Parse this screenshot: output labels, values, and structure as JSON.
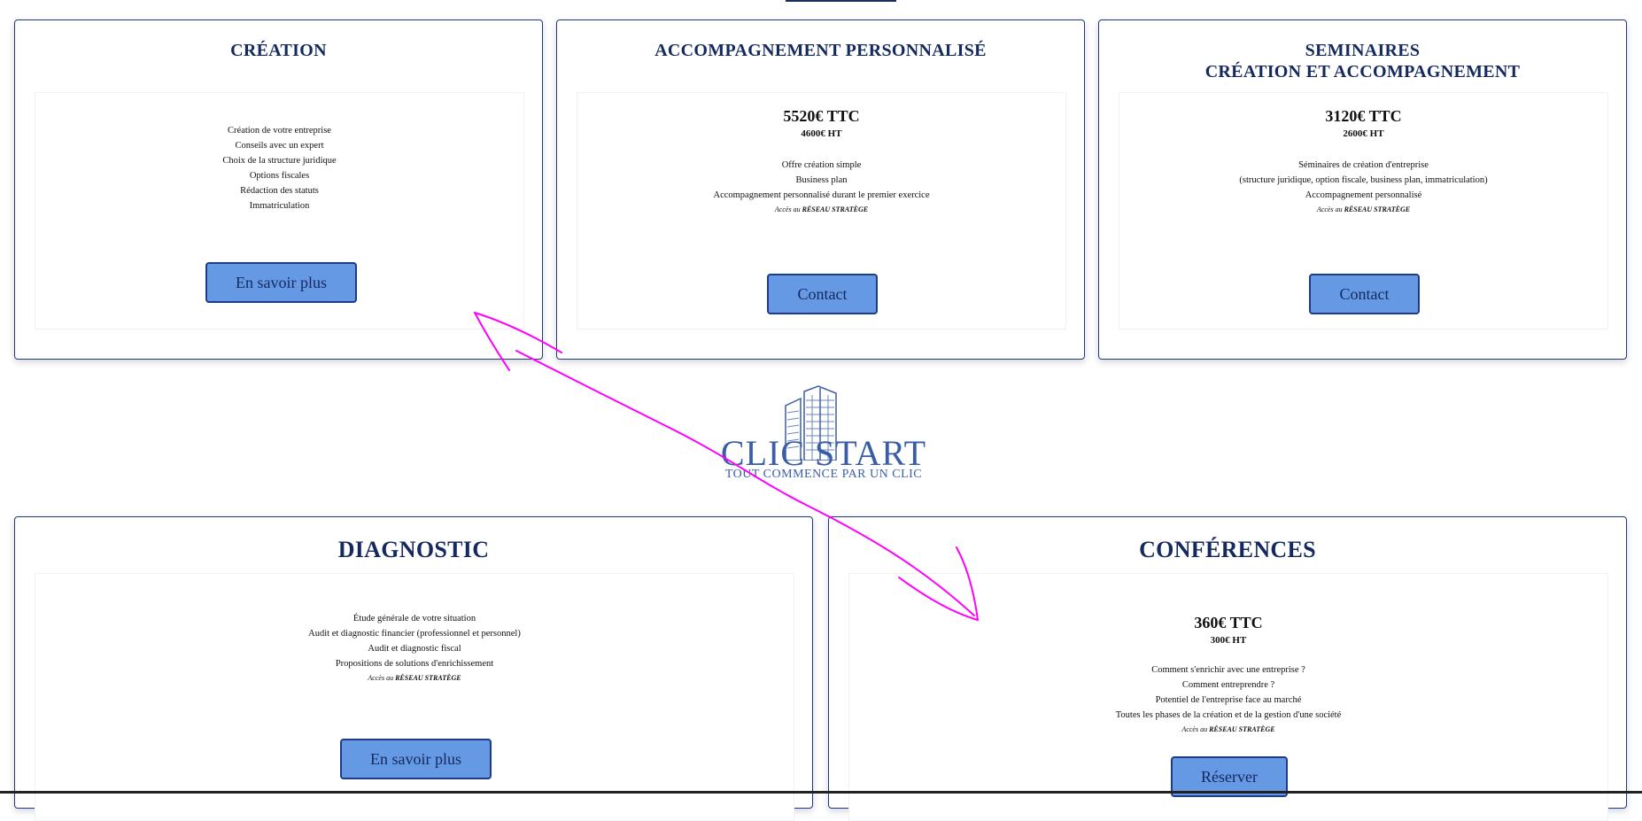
{
  "cards": {
    "creation": {
      "title": "CRÉATION",
      "lines": [
        "Création de votre entreprise",
        "Conseils avec un expert",
        "Choix de la structure juridique",
        "Options fiscales",
        "Rédaction des statuts",
        "Immatriculation"
      ],
      "button": "En savoir plus"
    },
    "accompagnement": {
      "title": "ACCOMPAGNEMENT PERSONNALISÉ",
      "price_ttc": "5520€ TTC",
      "price_ht": "4600€ HT",
      "lines": [
        "Offre création simple",
        "Business plan",
        "Accompagnement personnalisé durant le premier exercice"
      ],
      "note_prefix": "Accès au ",
      "note_brand": "RÉSEAU STRATÈGE",
      "button": "Contact"
    },
    "seminaires": {
      "title_line1": "SEMINAIRES",
      "title_line2": "CRÉATION ET ACCOMPAGNEMENT",
      "price_ttc": "3120€ TTC",
      "price_ht": "2600€ HT",
      "lines": [
        "Séminaires de création d'entreprise",
        "(structure juridique, option fiscale, business plan, immatriculation)",
        "Accompagnement personnalisé"
      ],
      "note_prefix": "Accès au ",
      "note_brand": "RÉSEAU STRATÈGE",
      "button": "Contact"
    },
    "diagnostic": {
      "title": "DIAGNOSTIC",
      "lines": [
        "Étude générale de votre situation",
        "Audit et diagnostic financier (professionnel et personnel)",
        "Audit et diagnostic fiscal",
        "Propositions de solutions d'enrichissement"
      ],
      "note_prefix": "Accès au ",
      "note_brand": "RÉSEAU STRATÈGE",
      "button": "En savoir plus"
    },
    "conferences": {
      "title": "CONFÉRENCES",
      "price_ttc": "360€ TTC",
      "price_ht": "300€ HT",
      "lines": [
        "Comment s'enrichir avec une entreprise ?",
        "Comment entreprendre ?",
        "Potentiel de l'entreprise face au marché",
        "Toutes les phases de la création et de la gestion d'une société"
      ],
      "note_prefix": "Accès au ",
      "note_brand": "RÉSEAU STRATÈGE",
      "button": "Réserver"
    }
  },
  "logo": {
    "name": "CLIC START",
    "tagline": "TOUT COMMENCE PAR UN CLIC",
    "icon": "skyscraper-icon"
  },
  "colors": {
    "title": "#14295e",
    "border": "#1f3878",
    "button_bg": "#6699e4",
    "logo": "#3a5da8",
    "annotation": "#ff00ff"
  }
}
